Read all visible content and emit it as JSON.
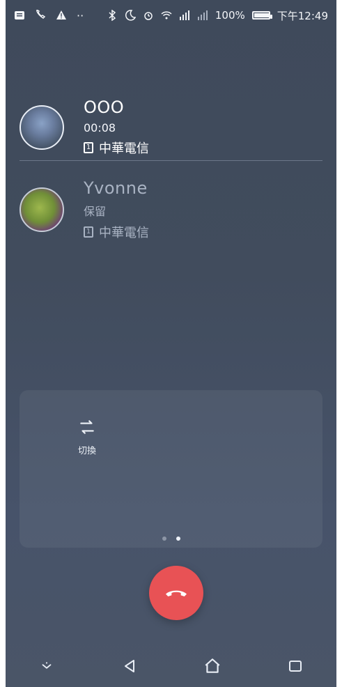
{
  "statusbar": {
    "battery_percent": "100%",
    "time": "下午12:49"
  },
  "calls": [
    {
      "name": "OOO",
      "detail": "00:08",
      "operator": "中華電信",
      "sim": "1"
    },
    {
      "name": "Yvonne",
      "detail": "保留",
      "operator": "中華電信",
      "sim": "1"
    }
  ],
  "panel": {
    "swap_label": "切換"
  },
  "colors": {
    "end_call": "#e85255",
    "background": "#414c5d"
  }
}
